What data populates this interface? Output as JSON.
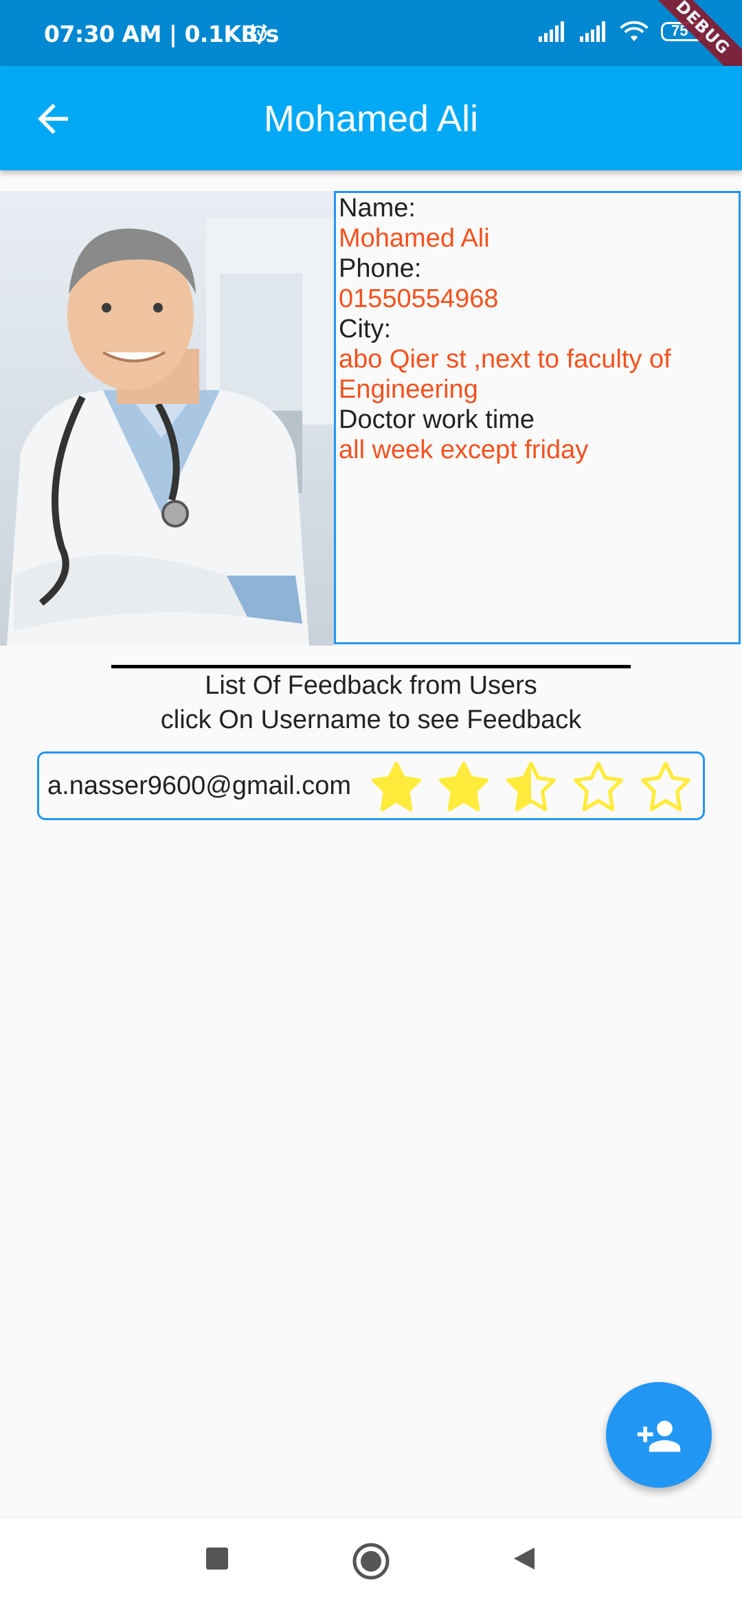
{
  "status_bar": {
    "time_speed": "07:30 AM | 0.1KB/s",
    "battery": "75",
    "debug": "DEBUG"
  },
  "app_bar": {
    "title": "Mohamed Ali"
  },
  "profile": {
    "name_label": "Name:",
    "name_value": "Mohamed Ali",
    "phone_label": "Phone:",
    "phone_value": "01550554968",
    "city_label": "City:",
    "city_value": "abo Qier st ,next to faculty of Engineering",
    "work_time_label": "Doctor work time",
    "work_time_value": "all week except friday"
  },
  "feedback": {
    "title": "List Of Feedback from Users",
    "subtitle": "click On Username to see Feedback",
    "items": [
      {
        "email": "a.nasser9600@gmail.com",
        "rating": 2.5,
        "max_rating": 5
      }
    ]
  },
  "colors": {
    "app_bar": "#03a9f4",
    "status_bar": "#0288d1",
    "accent": "#2196f3",
    "value_text": "#f4511e",
    "star": "#ffeb3b"
  },
  "icons": {
    "back": "arrow-back-icon",
    "fab": "person-add-icon",
    "nav": [
      "square-icon",
      "circle-icon",
      "triangle-back-icon"
    ]
  }
}
